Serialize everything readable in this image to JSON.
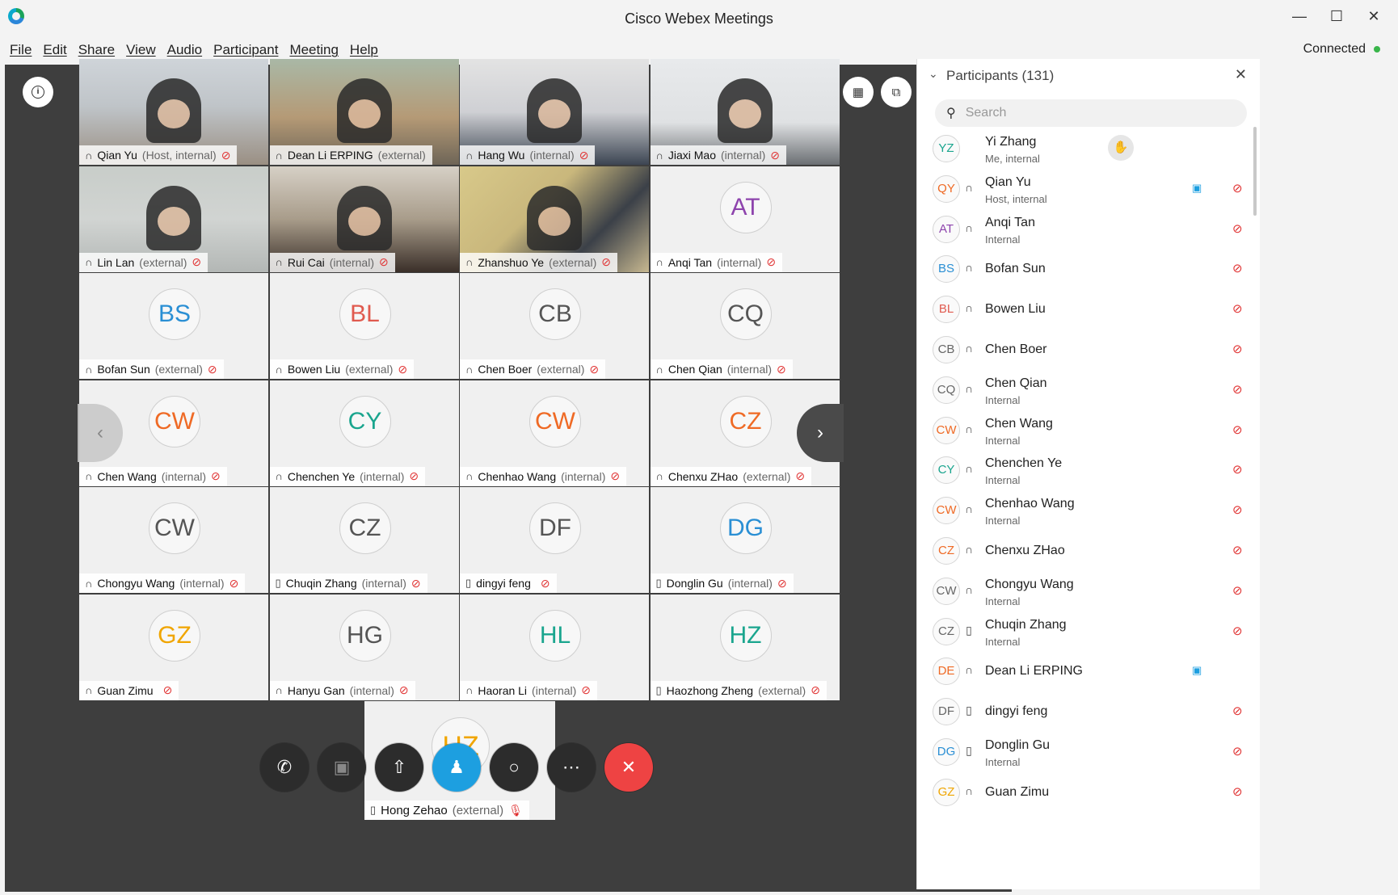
{
  "window": {
    "title": "Cisco Webex Meetings",
    "status": "Connected",
    "controls": [
      "minimize",
      "maximize",
      "close"
    ]
  },
  "menu": [
    "File",
    "Edit",
    "Share",
    "View",
    "Audio",
    "Participant",
    "Meeting",
    "Help"
  ],
  "tiles": [
    {
      "name": "Qian Yu",
      "sub": "(Host, internal)",
      "video": true,
      "muted": true
    },
    {
      "name": "Dean Li ERPING",
      "sub": "(external)",
      "video": true,
      "muted": false,
      "active": true
    },
    {
      "name": "Hang Wu",
      "sub": "(internal)",
      "video": true,
      "muted": true
    },
    {
      "name": "Jiaxi Mao",
      "sub": "(internal)",
      "video": true,
      "muted": true
    },
    {
      "name": "Lin Lan",
      "sub": "(external)",
      "video": true,
      "muted": true
    },
    {
      "name": "Rui Cai",
      "sub": "(internal)",
      "video": true,
      "muted": true
    },
    {
      "name": "Zhanshuo Ye",
      "sub": "(external)",
      "video": true,
      "muted": true
    },
    {
      "name": "Anqi Tan",
      "sub": "(internal)",
      "initials": "AT",
      "color": "#8e44ad",
      "muted": true
    },
    {
      "name": "Bofan Sun",
      "sub": "(external)",
      "initials": "BS",
      "color": "#2a8fd4",
      "muted": true
    },
    {
      "name": "Bowen Liu",
      "sub": "(external)",
      "initials": "BL",
      "color": "#e05a4f",
      "muted": true
    },
    {
      "name": "Chen Boer",
      "sub": "(external)",
      "initials": "CB",
      "color": "#555555",
      "muted": true
    },
    {
      "name": "Chen Qian",
      "sub": "(internal)",
      "initials": "CQ",
      "color": "#555555",
      "muted": true
    },
    {
      "name": "Chen Wang",
      "sub": "(internal)",
      "initials": "CW",
      "color": "#ef6a25",
      "muted": true
    },
    {
      "name": "Chenchen Ye",
      "sub": "(internal)",
      "initials": "CY",
      "color": "#1aa58e",
      "muted": true
    },
    {
      "name": "Chenhao Wang",
      "sub": "(internal)",
      "initials": "CW",
      "color": "#ef6a25",
      "muted": true
    },
    {
      "name": "Chenxu ZHao",
      "sub": "(external)",
      "initials": "CZ",
      "color": "#ef6a25",
      "muted": true
    },
    {
      "name": "Chongyu Wang",
      "sub": "(internal)",
      "initials": "CW",
      "color": "#555555",
      "muted": true
    },
    {
      "name": "Chuqin Zhang",
      "sub": "(internal)",
      "initials": "CZ",
      "color": "#555555",
      "muted": true,
      "device": "phone"
    },
    {
      "name": "dingyi feng",
      "sub": "",
      "initials": "DF",
      "color": "#555555",
      "muted": true,
      "device": "phone"
    },
    {
      "name": "Donglin Gu",
      "sub": "(internal)",
      "initials": "DG",
      "color": "#2a8fd4",
      "muted": true,
      "device": "phone"
    },
    {
      "name": "Guan Zimu",
      "sub": "",
      "initials": "GZ",
      "color": "#f0a500",
      "muted": true
    },
    {
      "name": "Hanyu Gan",
      "sub": "(internal)",
      "initials": "HG",
      "color": "#555555",
      "muted": true
    },
    {
      "name": "Haoran Li",
      "sub": "(internal)",
      "initials": "HL",
      "color": "#1aa58e",
      "muted": true
    },
    {
      "name": "Haozhong Zheng",
      "sub": "(external)",
      "initials": "HZ",
      "color": "#1aa58e",
      "muted": true,
      "device": "phone"
    }
  ],
  "self_tile": {
    "name": "Hong Zehao",
    "sub": "(external)",
    "initials": "HZ"
  },
  "controls": [
    "audio",
    "video",
    "share",
    "participants",
    "chat",
    "more",
    "leave"
  ],
  "participants": {
    "title": "Participants (131)",
    "search_placeholder": "Search",
    "list": [
      {
        "initials": "YZ",
        "color": "#1aa58e",
        "name": "Yi Zhang",
        "sub": "Me, internal",
        "raise": true
      },
      {
        "initials": "QY",
        "color": "#ef6a25",
        "name": "Qian Yu",
        "sub": "Host, internal",
        "video": true,
        "muted": true,
        "host": true
      },
      {
        "initials": "AT",
        "color": "#8e44ad",
        "name": "Anqi Tan",
        "sub": "Internal",
        "muted": true
      },
      {
        "initials": "BS",
        "color": "#2a8fd4",
        "name": "Bofan Sun",
        "sub": "",
        "muted": true
      },
      {
        "initials": "BL",
        "color": "#e05a4f",
        "name": "Bowen Liu",
        "sub": "",
        "muted": true
      },
      {
        "initials": "CB",
        "color": "#666666",
        "name": "Chen Boer",
        "sub": "",
        "muted": true
      },
      {
        "initials": "CQ",
        "color": "#666666",
        "name": "Chen Qian",
        "sub": "Internal",
        "muted": true
      },
      {
        "initials": "CW",
        "color": "#ef6a25",
        "name": "Chen Wang",
        "sub": "Internal",
        "muted": true
      },
      {
        "initials": "CY",
        "color": "#1aa58e",
        "name": "Chenchen Ye",
        "sub": "Internal",
        "muted": true
      },
      {
        "initials": "CW",
        "color": "#ef6a25",
        "name": "Chenhao Wang",
        "sub": "Internal",
        "muted": true
      },
      {
        "initials": "CZ",
        "color": "#ef6a25",
        "name": "Chenxu ZHao",
        "sub": "",
        "muted": true
      },
      {
        "initials": "CW",
        "color": "#666666",
        "name": "Chongyu Wang",
        "sub": "Internal",
        "muted": true
      },
      {
        "initials": "CZ",
        "color": "#666666",
        "name": "Chuqin Zhang",
        "sub": "Internal",
        "muted": true,
        "device": "phone"
      },
      {
        "initials": "DE",
        "color": "#ef6a25",
        "name": "Dean Li ERPING",
        "sub": "",
        "video": true
      },
      {
        "initials": "DF",
        "color": "#666666",
        "name": "dingyi feng",
        "sub": "",
        "muted": true,
        "device": "phone"
      },
      {
        "initials": "DG",
        "color": "#2a8fd4",
        "name": "Donglin Gu",
        "sub": "Internal",
        "muted": true,
        "device": "phone"
      },
      {
        "initials": "GZ",
        "color": "#f0a500",
        "name": "Guan Zimu",
        "sub": "",
        "muted": true
      }
    ]
  }
}
